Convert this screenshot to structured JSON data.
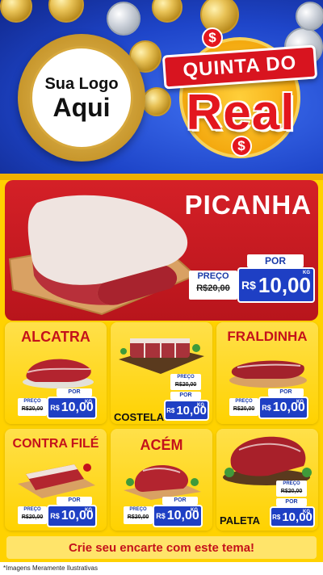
{
  "header": {
    "logo_line1": "Sua Logo",
    "logo_line2": "Aqui",
    "brand_top": "QUINTA DO",
    "brand_main": "Real",
    "dollar_symbol": "$"
  },
  "hero": {
    "name": "PICANHA",
    "preco_label": "PREÇO",
    "old_price": "R$20,00",
    "por_label": "POR",
    "currency": "R$",
    "price": "10,00",
    "unit": "KG"
  },
  "products": [
    {
      "name": "ALCATRA",
      "preco_label": "PREÇO",
      "old_price": "R$20,00",
      "por_label": "POR",
      "currency": "R$",
      "price": "10,00",
      "unit": "KG"
    },
    {
      "name": "COSTELA",
      "preco_label": "PREÇO",
      "old_price": "R$20,00",
      "por_label": "POR",
      "currency": "R$",
      "price": "10,00",
      "unit": "KG"
    },
    {
      "name": "FRALDINHA",
      "preco_label": "PREÇO",
      "old_price": "R$20,00",
      "por_label": "POR",
      "currency": "R$",
      "price": "10,00",
      "unit": "KG"
    },
    {
      "name": "CONTRA FILÉ",
      "preco_label": "PREÇO",
      "old_price": "R$20,00",
      "por_label": "POR",
      "currency": "R$",
      "price": "10,00",
      "unit": "KG"
    },
    {
      "name": "ACÉM",
      "preco_label": "PREÇO",
      "old_price": "R$20,00",
      "por_label": "POR",
      "currency": "R$",
      "price": "10,00",
      "unit": "KG"
    },
    {
      "name": "PALETA",
      "preco_label": "PREÇO",
      "old_price": "R$20,00",
      "por_label": "POR",
      "currency": "R$",
      "price": "10,00",
      "unit": "KG"
    }
  ],
  "footer": {
    "cta": "Crie seu encarte com este tema!",
    "disclaimer": "*Imagens Meramente Ilustrativas"
  },
  "colors": {
    "header_blue": "#1e45c9",
    "brand_red": "#e3161e",
    "background_yellow": "#ffd200",
    "price_blue": "#1e3fc4"
  }
}
